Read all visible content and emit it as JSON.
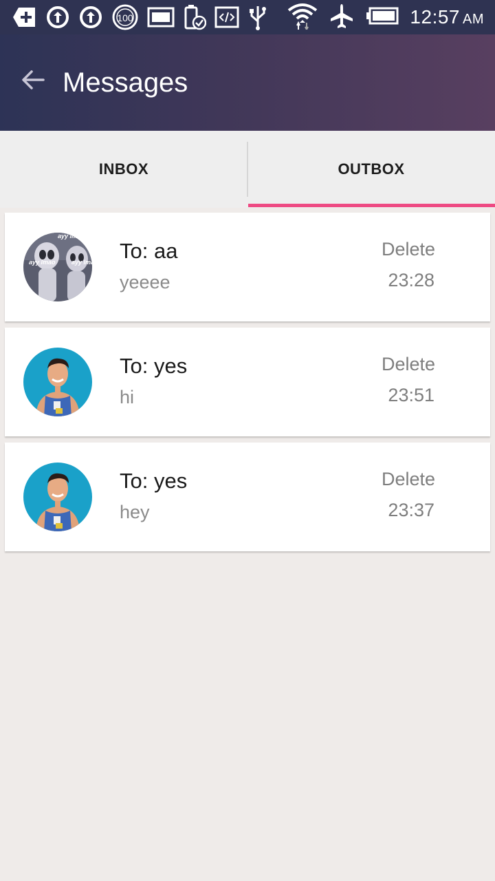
{
  "status_bar": {
    "time": "12:57",
    "ampm": "AM",
    "icons": [
      "add-icon",
      "sync-icon",
      "sync-icon",
      "battery-100-icon",
      "image-icon",
      "battery-check-icon",
      "code-icon",
      "usb-icon",
      "wifi-icon",
      "airplane-icon",
      "battery-icon"
    ]
  },
  "app_bar": {
    "title": "Messages",
    "back_icon": "arrow-back-icon"
  },
  "tabs": [
    {
      "label": "INBOX",
      "selected": false
    },
    {
      "label": "OUTBOX",
      "selected": true
    }
  ],
  "accent_color": "#ee4a83",
  "messages": [
    {
      "recipient": "To: aa",
      "preview": "yeeee",
      "action": "Delete",
      "time": "23:28",
      "avatar": "alien-meme-avatar",
      "avatar_text": "ayy lmao"
    },
    {
      "recipient": "To: yes",
      "preview": "hi",
      "action": "Delete",
      "time": "23:51",
      "avatar": "person-avatar"
    },
    {
      "recipient": "To: yes",
      "preview": "hey",
      "action": "Delete",
      "time": "23:37",
      "avatar": "person-avatar"
    }
  ]
}
